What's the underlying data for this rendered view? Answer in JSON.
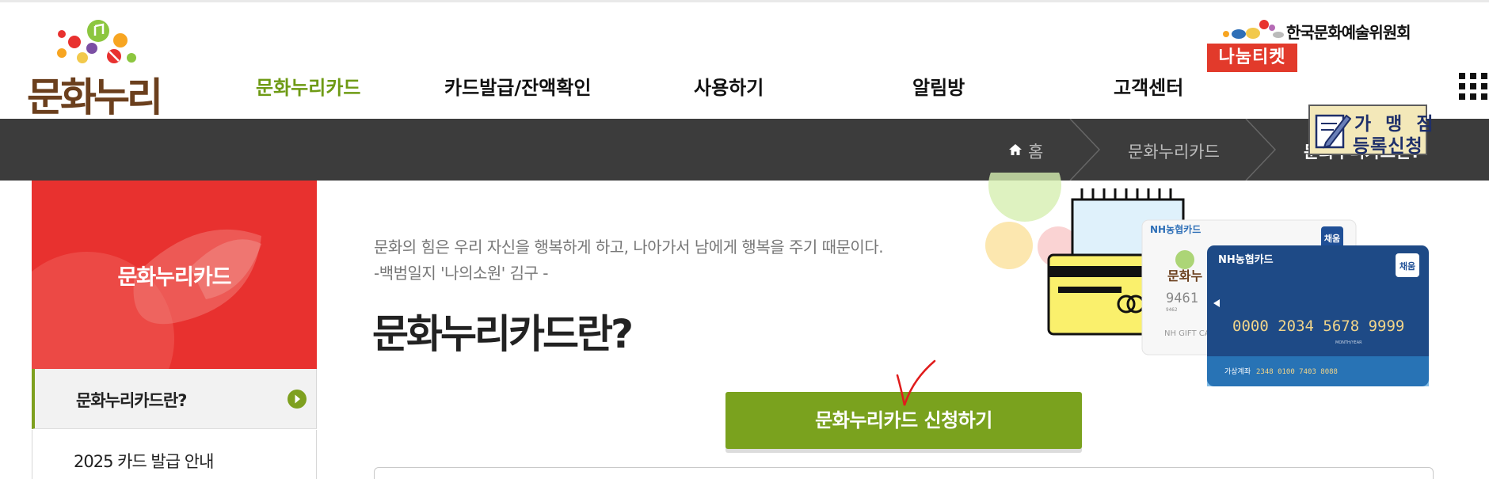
{
  "header": {
    "logo_text": "문화누리",
    "nav": [
      {
        "label": "문화누리카드",
        "active": true
      },
      {
        "label": "카드발급/잔액확인",
        "active": false
      },
      {
        "label": "사용하기",
        "active": false
      },
      {
        "label": "알림방",
        "active": false
      },
      {
        "label": "고객센터",
        "active": false
      }
    ],
    "arko_label": "한국문화예술위원회",
    "nanum_ticket_label": "나눔티켓",
    "all_menu_icon": "grid-menu-icon"
  },
  "breadcrumb": {
    "home_icon": "home-icon",
    "items": [
      "홈",
      "문화누리카드",
      "문화누리카드란?"
    ]
  },
  "merchant_banner": {
    "line1": "가 맹 점",
    "line2": "등록신청"
  },
  "sidebar": {
    "title": "문화누리카드",
    "items": [
      {
        "label": "문화누리카드란?",
        "active": true
      },
      {
        "label": "2025 카드 발급 안내",
        "active": false
      }
    ]
  },
  "main": {
    "quote_line1": "문화의 힘은 우리 자신을 행복하게 하고, 나아가서 남에게 행복을 주기 때문이다.",
    "quote_line2": "-백범일지 '나의소원' 김구 -",
    "title": "문화누리카드란?",
    "apply_button": "문화누리카드 신청하기"
  },
  "illustration": {
    "card_brand": "NH농협카드",
    "card_badge": "채움",
    "card_number": "0000 2034 5678 9999",
    "back_card_number": "9461",
    "back_card_small": "9462",
    "back_card_label": "NH GIFT CA",
    "back_card_logo": "문화누",
    "card_month_year": "MONTH/YEAR",
    "card_account": "가상계좌",
    "card_account_number": "2348 0100 7403 8088"
  },
  "colors": {
    "brand_green": "#7aa21e",
    "nav_active": "#6e9a14",
    "sidebar_red": "#e8312f",
    "breadcrumb_bg": "#3c3c3c"
  }
}
